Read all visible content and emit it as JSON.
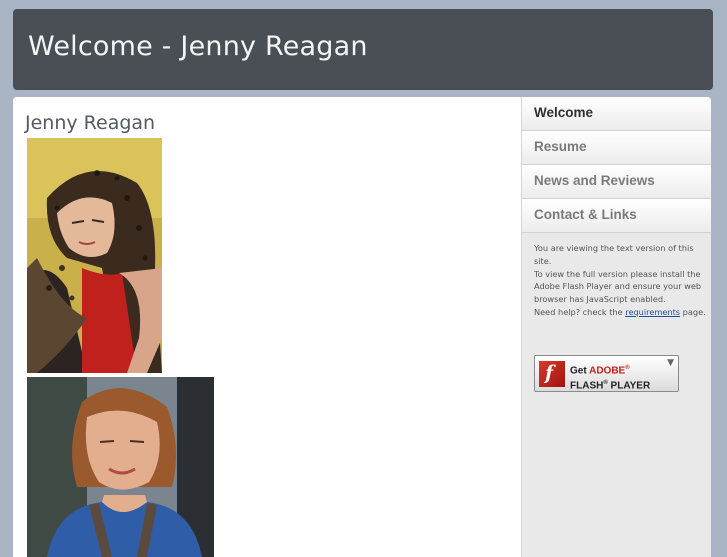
{
  "header": {
    "title": "Welcome - Jenny Reagan"
  },
  "main": {
    "page_title": "Jenny Reagan",
    "photos": [
      {
        "icon": "portrait-photo-headscarf"
      },
      {
        "icon": "portrait-photo-smiling"
      }
    ]
  },
  "sidebar": {
    "items": [
      {
        "label": "Welcome",
        "active": true
      },
      {
        "label": "Resume",
        "active": false
      },
      {
        "label": "News and Reviews",
        "active": false
      },
      {
        "label": "Contact & Links",
        "active": false
      }
    ],
    "notice": {
      "line1": "You are viewing the text version of this site.",
      "line2": "To view the full version please install the Adobe Flash Player and ensure your web browser has JavaScript enabled.",
      "line3_prefix": "Need help? check the ",
      "link": "requirements",
      "line3_suffix": " page."
    },
    "flash_badge": {
      "get": "Get",
      "adobe": "ADOBE",
      "product": "FLASH",
      "player": "PLAYER",
      "icon": "flash-f-logo"
    }
  },
  "colors": {
    "page_bg": "#a9b4c4",
    "header_bg": "#4a4e55",
    "accent_red": "#c4201d"
  }
}
